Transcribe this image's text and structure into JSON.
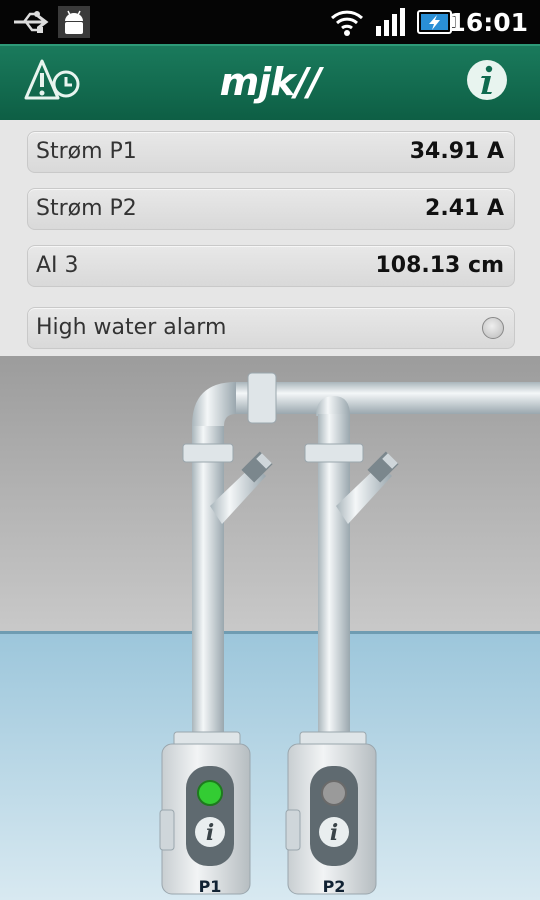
{
  "status_bar": {
    "time": "16:01",
    "icons": [
      "usb-icon",
      "android-icon",
      "wifi-icon",
      "signal-icon",
      "battery-charging-icon"
    ]
  },
  "header": {
    "logo_text": "mjk//",
    "left_icon": "alarm-clock-warning-icon",
    "right_icon": "info-icon",
    "color": "#0f6a4f"
  },
  "readings": [
    {
      "label": "Strøm P1",
      "value": "34.91 A"
    },
    {
      "label": "Strøm P2",
      "value": "2.41 A"
    },
    {
      "label": "AI 3",
      "value": "108.13 cm"
    }
  ],
  "alarm": {
    "label": "High water alarm",
    "active": false
  },
  "pumps": [
    {
      "label": "P1",
      "status_color": "#33cc33",
      "running": true
    },
    {
      "label": "P2",
      "status_color": "#9a9a9a",
      "running": false
    }
  ],
  "colors": {
    "water": "#9ec8dc",
    "wall": "#b3b3b3",
    "accent": "#0f6a4f"
  }
}
